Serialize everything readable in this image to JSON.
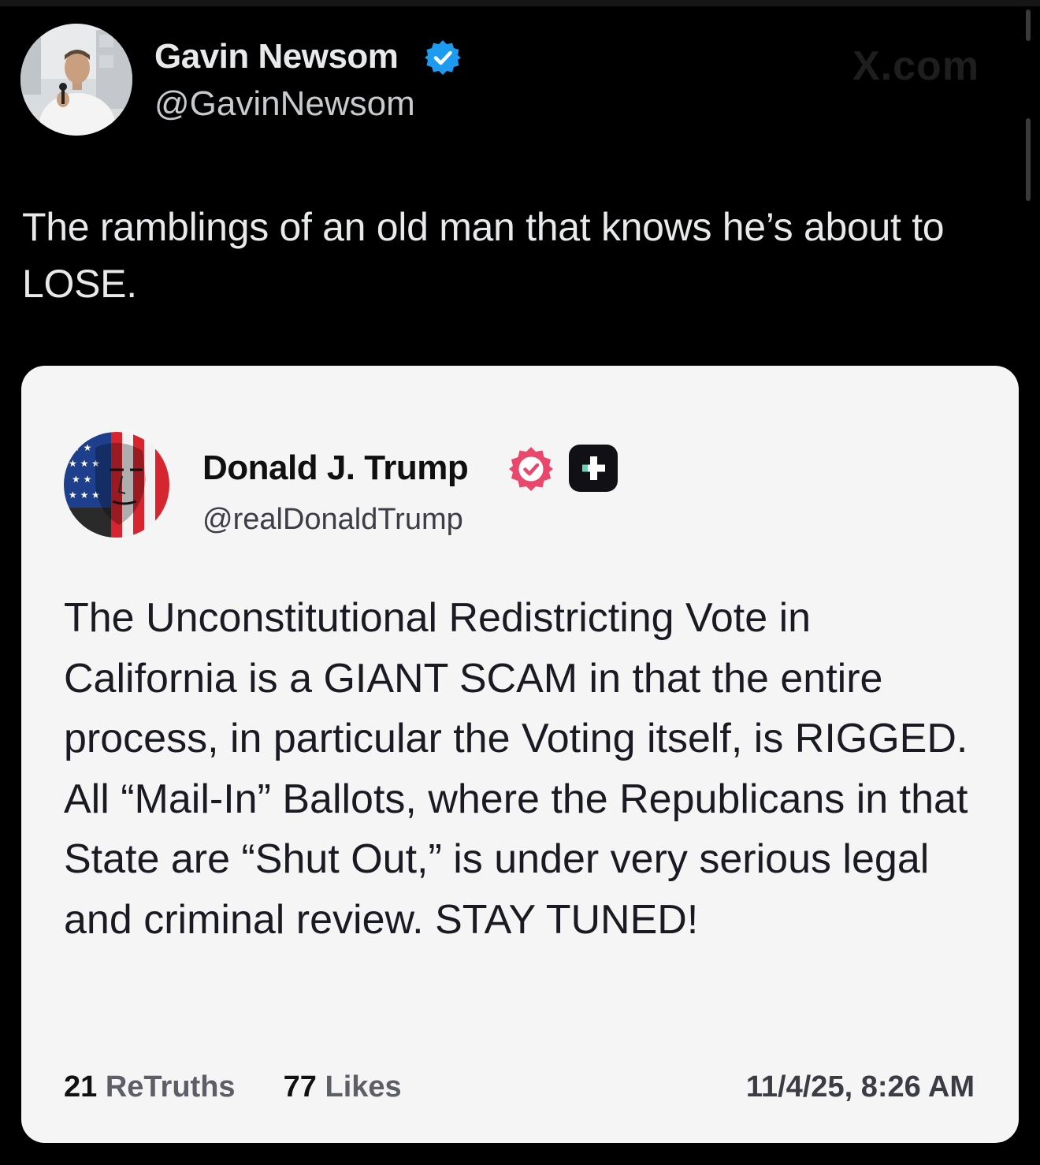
{
  "post": {
    "author_name": "Gavin Newsom",
    "author_handle": "@GavinNewsom",
    "watermark": "X.com",
    "text": "The ramblings of an old man that knows he’s about to LOSE."
  },
  "quoted_post": {
    "author_name": "Donald J. Trump",
    "author_handle": "@realDonaldTrump",
    "text": "The Unconstitutional Redistricting Vote in California is a GIANT SCAM in that the entire process, in particular the Voting itself, is RIGGED. All “Mail-In” Ballots, where the Republicans in that State are “Shut Out,” is under very serious legal and criminal review. STAY TUNED!",
    "retruths_count": "21",
    "retruths_label": "ReTruths",
    "likes_count": "77",
    "likes_label": "Likes",
    "timestamp": "11/4/25, 8:26 AM"
  },
  "icons": {
    "verified_badge": "verified-check-icon",
    "truth_badge": "pink-verified-icon",
    "plus_badge": "plus-icon"
  },
  "colors": {
    "background": "#000000",
    "card": "#f5f5f5",
    "verified_blue": "#1d9bf0",
    "truth_pink": "#e9476b"
  }
}
